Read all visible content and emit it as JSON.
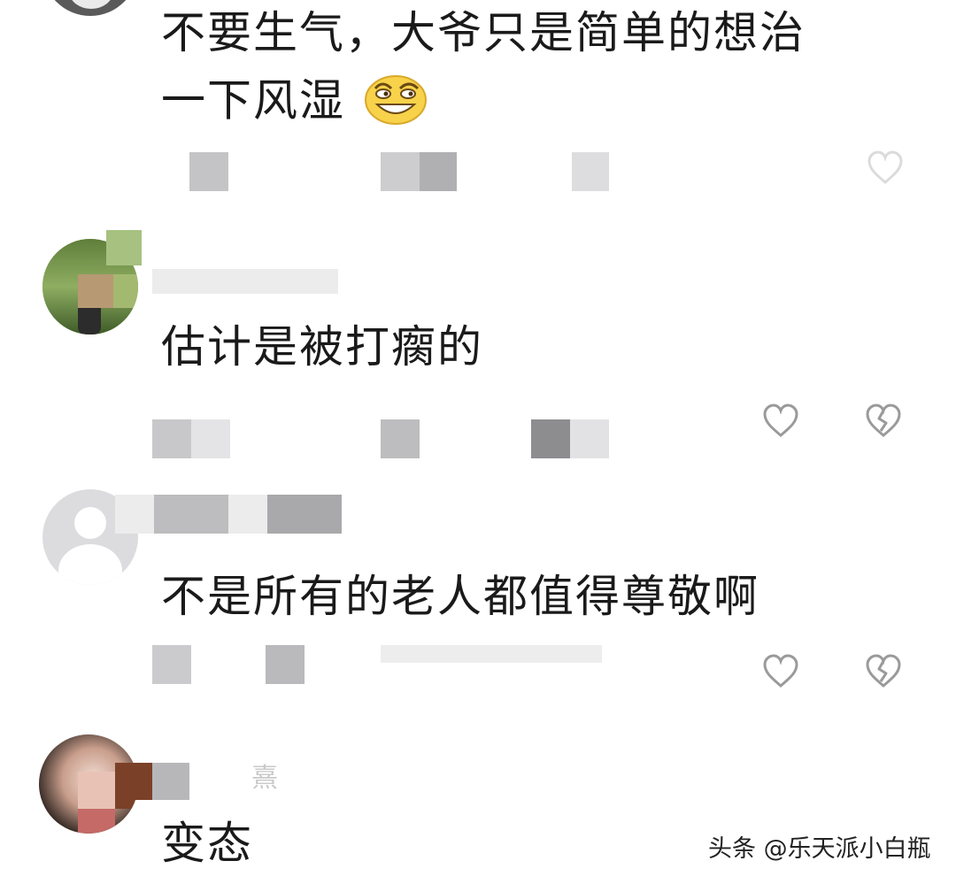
{
  "comments": [
    {
      "text_line1": "不要生气，大爷只是简单的想治",
      "text_line2": "一下风湿",
      "emoji": "grinning-squint-emoji"
    },
    {
      "username": "",
      "text": "估计是被打瘸的"
    },
    {
      "username": "",
      "text": "不是所有的老人都值得尊敬啊"
    },
    {
      "username": "",
      "username_fragment": "熹",
      "text": "变态"
    }
  ],
  "icons": {
    "like": "heart-outline-icon",
    "dislike": "broken-heart-icon"
  },
  "watermark": "头条 @乐天派小白瓶",
  "colors": {
    "text": "#1a1a1a",
    "icon": "#9a9a9a",
    "mosaic_gray": "#b7b7b9",
    "emoji_yellow": "#f7d24a"
  }
}
